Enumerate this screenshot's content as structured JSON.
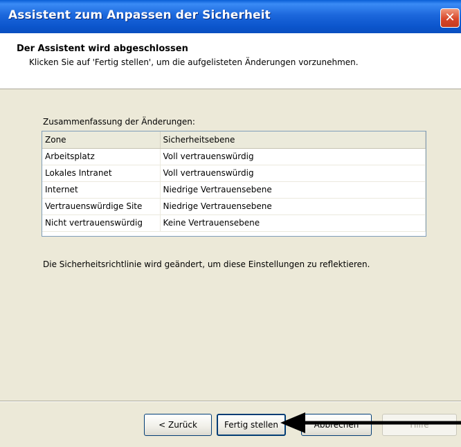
{
  "window": {
    "title": "Assistent zum Anpassen der Sicherheit",
    "close_glyph": "✕"
  },
  "header": {
    "title": "Der Assistent wird abgeschlossen",
    "description": "Klicken Sie auf 'Fertig stellen', um die aufgelisteten Änderungen vorzunehmen."
  },
  "summary": {
    "label": "Zusammenfassung der Änderungen:",
    "columns": [
      "Zone",
      "Sicherheitsebene"
    ],
    "rows": [
      [
        "Arbeitsplatz",
        "Voll vertrauenswürdig"
      ],
      [
        "Lokales Intranet",
        "Voll vertrauenswürdig"
      ],
      [
        "Internet",
        "Niedrige Vertrauensebene"
      ],
      [
        "Vertrauenswürdige Site",
        "Niedrige Vertrauensebene"
      ],
      [
        "Nicht vertrauenswürdig",
        "Keine Vertrauensebene"
      ]
    ]
  },
  "footer_text": "Die Sicherheitsrichtlinie wird geändert, um diese Einstellungen zu reflektieren.",
  "buttons": {
    "back": "< Zurück",
    "finish": "Fertig stellen",
    "cancel": "Abbrechen",
    "help": "Hilfe"
  },
  "annotation": {
    "arrow_icon": "arrow-left-icon",
    "arrow_color": "#000000"
  },
  "colors": {
    "titlebar": "#0b55cc",
    "dialog_bg": "#ece9d8",
    "close_button": "#d8472a"
  }
}
